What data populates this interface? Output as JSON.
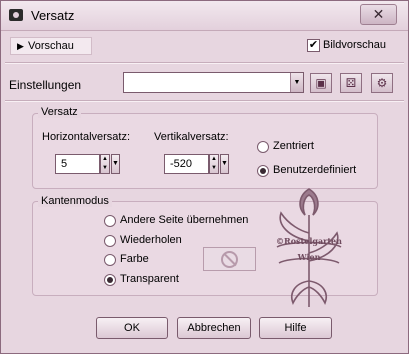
{
  "window": {
    "title": "Versatz",
    "close_glyph": "✕"
  },
  "preview": {
    "label": "Vorschau",
    "bild_label": "Bildvorschau",
    "bild_checked": true
  },
  "settings": {
    "label": "Einstellungen",
    "value": ""
  },
  "versatz_group": {
    "title": "Versatz",
    "horizontal_label": "Horizontalversatz:",
    "horizontal_value": "5",
    "vertical_label": "Vertikalversatz:",
    "vertical_value": "-520",
    "options": [
      {
        "label": "Zentriert",
        "selected": false
      },
      {
        "label": "Benutzerdefiniert",
        "selected": true
      }
    ]
  },
  "kanten_group": {
    "title": "Kantenmodus",
    "options": [
      {
        "label": "Andere Seite übernehmen",
        "selected": false
      },
      {
        "label": "Wiederholen",
        "selected": false
      },
      {
        "label": "Farbe",
        "selected": false
      },
      {
        "label": "Transparent",
        "selected": true
      }
    ]
  },
  "watermark": {
    "line1": "©Rostelgarten",
    "line2": "Wien"
  },
  "buttons": {
    "ok": "OK",
    "cancel": "Abbrechen",
    "help": "Hilfe"
  },
  "icons": {
    "camera": "camera-icon",
    "save": "floppy-disk-icon",
    "dice": "dice-icon",
    "load": "load-preset-icon",
    "no": "no-sign-icon"
  },
  "colors": {
    "background": "#e7d6e0",
    "border": "#7a5b6d"
  }
}
